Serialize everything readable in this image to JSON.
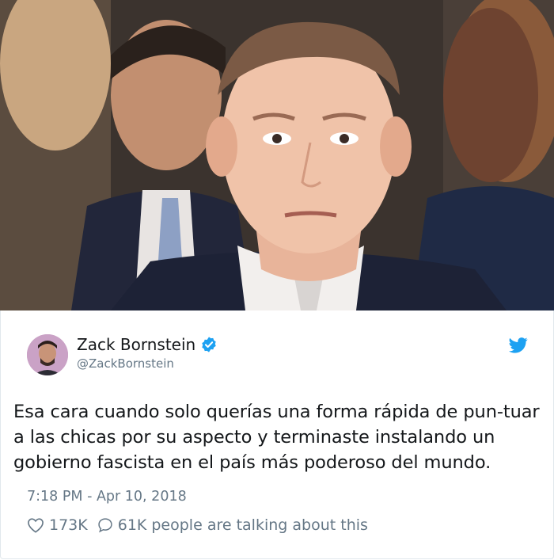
{
  "tweet": {
    "name": "Zack Bornstein",
    "handle": "@ZackBornstein",
    "text": "Esa cara cuando solo querías una forma rápida de pun-tuar a las chicas por su aspecto y terminaste instalando un gobierno fascista en el país más poderoso del mundo.",
    "timestamp": "7:18 PM - Apr 10, 2018",
    "likes": "173K",
    "replies": "61K",
    "talking_label": "people are talking about this"
  },
  "icons": {
    "verified": "verified-badge-icon",
    "bird": "twitter-bird-icon",
    "heart": "heart-icon",
    "reply": "reply-bubble-icon"
  },
  "colors": {
    "brand": "#1da1f2",
    "text": "#14171a",
    "muted": "#657786"
  }
}
